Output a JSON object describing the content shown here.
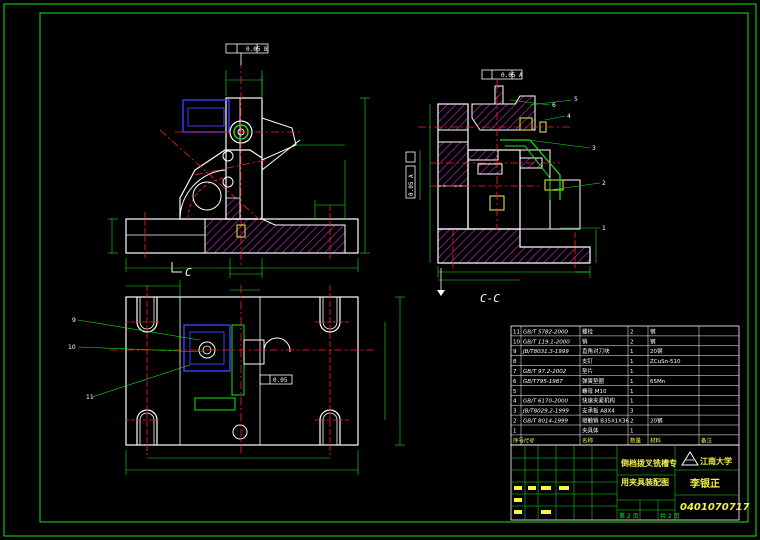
{
  "colors": {
    "background": "#000000",
    "frame": "#19e619",
    "outline": "#ffffff",
    "centerline": "#ff2020",
    "hatch": "#c832c8",
    "blue_part": "#3c3cff",
    "dimension": "#19e619",
    "yellow": "#f2f24a",
    "cyan": "#30e6e6"
  },
  "views": {
    "front_view_label": "C",
    "section_view_label": "C-C"
  },
  "tolerances": {
    "front_top": "0.05 B",
    "section_top": "0.05 A",
    "section_side": "0.05 A",
    "top_view_mid": "0.05"
  },
  "leaders": {
    "section": [
      "1",
      "2",
      "3",
      "4",
      "5",
      "6"
    ],
    "plan": [
      "9",
      "10",
      "11"
    ]
  },
  "bom": {
    "rows": [
      {
        "no": "11",
        "code": "GB/T 5782-2000",
        "name": "螺栓",
        "qty": "2",
        "material": "钢",
        "note": ""
      },
      {
        "no": "10",
        "code": "GB/T 119.1-2000",
        "name": "销",
        "qty": "2",
        "material": "钢",
        "note": ""
      },
      {
        "no": "9",
        "code": "JB/T8031.3-1999",
        "name": "直角对刀块",
        "qty": "1",
        "material": "20钢",
        "note": ""
      },
      {
        "no": "8",
        "code": "",
        "name": "支钉",
        "qty": "1",
        "material": "ZCuSn-510",
        "note": ""
      },
      {
        "no": "7",
        "code": "GB/T 97.2-2002",
        "name": "垫片",
        "qty": "1",
        "material": "",
        "note": ""
      },
      {
        "no": "6",
        "code": "GB/T795-1987",
        "name": "弹簧垫圈",
        "qty": "1",
        "material": "65Mn",
        "note": ""
      },
      {
        "no": "5",
        "code": "",
        "name": "螺母 M10",
        "qty": "1",
        "material": "",
        "note": ""
      },
      {
        "no": "4",
        "code": "GB/T 6170-2000",
        "name": "快速夹紧机构",
        "qty": "1",
        "material": "",
        "note": ""
      },
      {
        "no": "3",
        "code": "JB/T8029.2-1999",
        "name": "支承板 A8X4",
        "qty": "3",
        "material": "",
        "note": ""
      },
      {
        "no": "2",
        "code": "GB/T 8014-1999",
        "name": "接触销 B35X1X36",
        "qty": "2",
        "material": "20钢",
        "note": ""
      },
      {
        "no": "1",
        "code": "",
        "name": "夹具体",
        "qty": "1",
        "material": "",
        "note": ""
      }
    ],
    "header": {
      "no": "序号",
      "code": "代号",
      "name": "名称",
      "qty": "数量",
      "material": "材料",
      "note": "备注"
    }
  },
  "title_block": {
    "title_line1": "倒档拨叉铣槽专",
    "title_line2": "用夹具装配图",
    "university": "江南大学",
    "designer": "李银正",
    "student_id": "0401070717",
    "sheet_info": "第 2 页",
    "sheet_total": "共 2 页"
  }
}
